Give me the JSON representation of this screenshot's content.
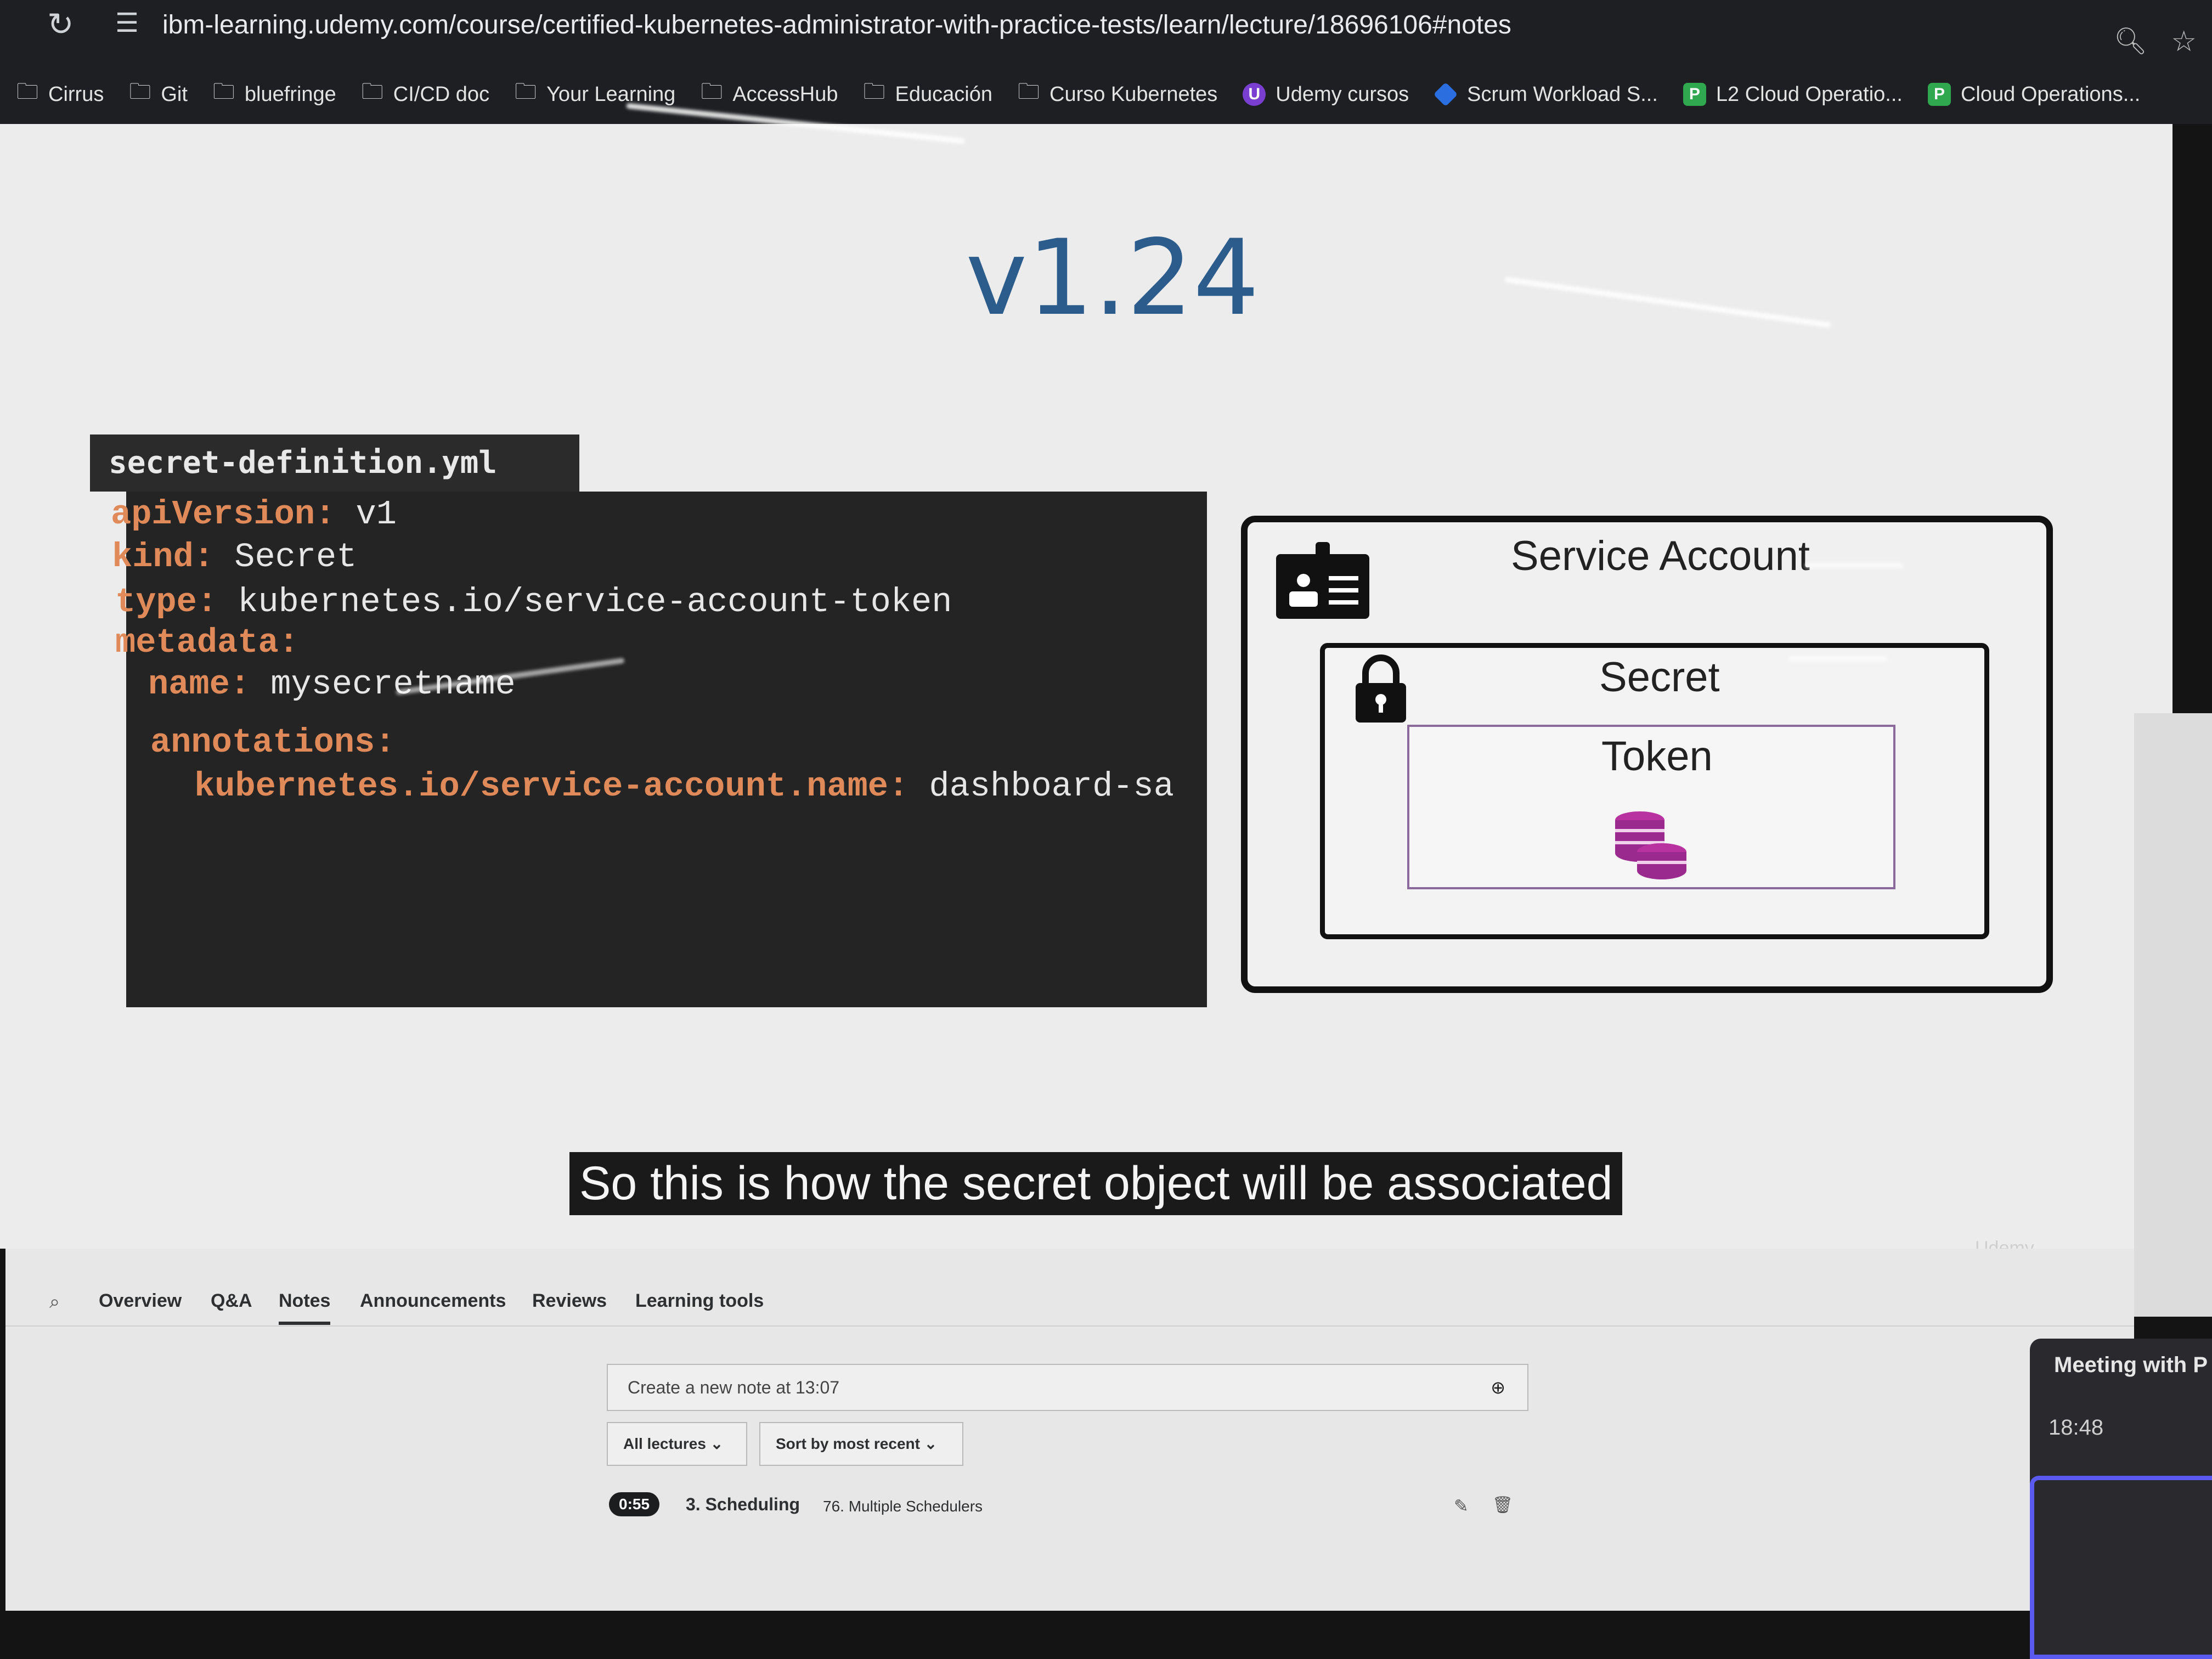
{
  "browser": {
    "url": "ibm-learning.udemy.com/course/certified-kubernetes-administrator-with-practice-tests/learn/lecture/18696106#notes",
    "bookmarks": [
      {
        "label": "Cirrus",
        "icon": "folder-icon"
      },
      {
        "label": "Git",
        "icon": "folder-icon"
      },
      {
        "label": "bluefringe",
        "icon": "folder-icon"
      },
      {
        "label": "CI/CD doc",
        "icon": "folder-icon"
      },
      {
        "label": "Your Learning",
        "icon": "folder-icon"
      },
      {
        "label": "AccessHub",
        "icon": "folder-icon"
      },
      {
        "label": "Educación",
        "icon": "folder-icon"
      },
      {
        "label": "Curso Kubernetes",
        "icon": "folder-icon"
      },
      {
        "label": "Udemy cursos",
        "icon": "udemy-icon"
      },
      {
        "label": "Scrum Workload S...",
        "icon": "jira-icon"
      },
      {
        "label": "L2 Cloud Operatio...",
        "icon": "p-icon"
      },
      {
        "label": "Cloud Operations...",
        "icon": "p-icon"
      }
    ]
  },
  "slide": {
    "version": "v1.24",
    "file_name": "secret-definition.yml",
    "code": [
      {
        "key": "apiVersion:",
        "value": " v1"
      },
      {
        "key": "kind:",
        "value": " Secret"
      },
      {
        "key": "type:",
        "value": " kubernetes.io/service-account-token"
      },
      {
        "key": "metadata:",
        "value": ""
      },
      {
        "key": "name:",
        "value": " mysecretname"
      },
      {
        "key": "annotations:",
        "value": ""
      },
      {
        "key": "kubernetes.io/service-account.name:",
        "value": " dashboard-sa"
      }
    ],
    "service_account_label": "Service Account",
    "secret_label": "Secret",
    "token_label": "Token",
    "caption": "So this is how the secret object will be associated",
    "watermark": "Udemy"
  },
  "course_tabs": {
    "items": [
      "Overview",
      "Q&A",
      "Notes",
      "Announcements",
      "Reviews",
      "Learning tools"
    ],
    "active": "Notes"
  },
  "notes": {
    "new_note_placeholder": "Create a new note at 13:07",
    "filter_lectures": "All lectures",
    "sort": "Sort by most recent",
    "entries": [
      {
        "time": "0:55",
        "section": "3. Scheduling",
        "lecture": "76. Multiple Schedulers"
      }
    ]
  },
  "meeting_popup": {
    "title": "Meeting with P",
    "time": "18:48"
  },
  "colors": {
    "version_blue": "#2c5c8c",
    "yaml_key": "#e08a5a",
    "coins_purple": "#9b2a8f"
  }
}
